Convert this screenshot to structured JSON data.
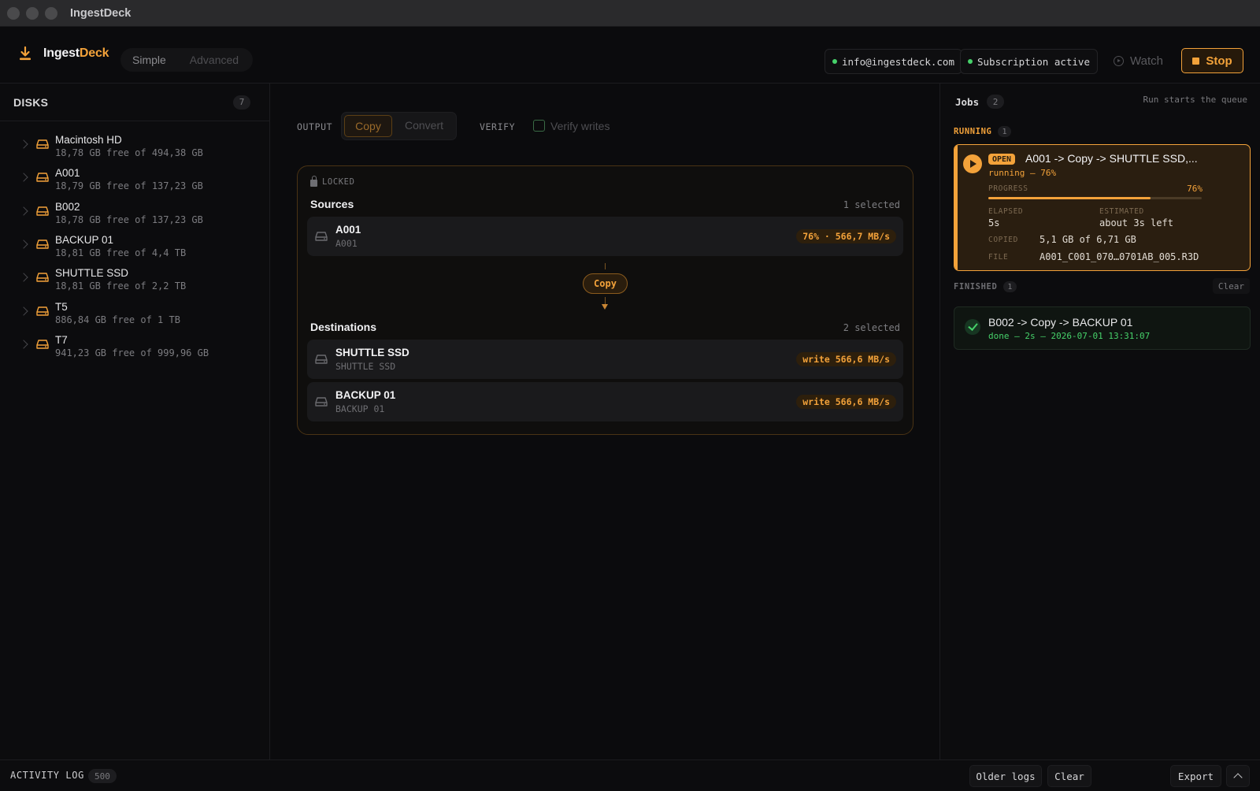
{
  "window": {
    "title": "IngestDeck"
  },
  "brand": {
    "name_main": "Ingest",
    "name_accent": "Deck"
  },
  "modes": [
    "Simple",
    "Advanced"
  ],
  "header": {
    "email": "info@ingestdeck.com",
    "subscription": "Subscription active",
    "watch_label": "Watch",
    "stop_label": "Stop"
  },
  "sidebar": {
    "title": "DISKS",
    "count": "7",
    "disks": [
      {
        "name": "Macintosh HD",
        "free": "18,78 GB free of 494,38 GB"
      },
      {
        "name": "A001",
        "free": "18,79 GB free of 137,23 GB"
      },
      {
        "name": "B002",
        "free": "18,78 GB free of 137,23 GB"
      },
      {
        "name": "BACKUP 01",
        "free": "18,81 GB free of 4,4 TB"
      },
      {
        "name": "SHUTTLE SSD",
        "free": "18,81 GB free of 2,2 TB"
      },
      {
        "name": "T5",
        "free": "886,84 GB free of 1 TB"
      },
      {
        "name": "T7",
        "free": "941,23 GB free of 999,96 GB"
      }
    ]
  },
  "toolbar": {
    "output_label": "OUTPUT",
    "copy": "Copy",
    "convert": "Convert",
    "verify_label": "VERIFY",
    "verify_writes": "Verify writes"
  },
  "flow": {
    "locked": "LOCKED",
    "sources_title": "Sources",
    "sources_count": "1 selected",
    "sources": [
      {
        "name": "A001",
        "sub": "A001",
        "tag": "76% · 566,7 MB/s"
      }
    ],
    "connector": "Copy",
    "dest_title": "Destinations",
    "dest_count": "2 selected",
    "destinations": [
      {
        "name": "SHUTTLE SSD",
        "sub": "SHUTTLE SSD",
        "tag": "write 566,6 MB/s"
      },
      {
        "name": "BACKUP 01",
        "sub": "BACKUP 01",
        "tag": "write 566,6 MB/s"
      }
    ]
  },
  "jobs": {
    "title": "Jobs",
    "count": "2",
    "note": "Run starts the queue",
    "running_label": "RUNNING",
    "running_count": "1",
    "running_job": {
      "tag": "OPEN",
      "title": "A001 -> Copy -> SHUTTLE SSD,...",
      "status": "running – 76%",
      "progress_label": "PROGRESS",
      "progress_pct": "76%",
      "progress_value": 0.76,
      "elapsed_label": "ELAPSED",
      "elapsed": "5s",
      "estimated_label": "ESTIMATED",
      "estimated": "about 3s left",
      "copied_label": "COPIED",
      "copied": "5,1 GB of 6,71 GB",
      "file_label": "FILE",
      "file": "A001_C001_070…0701AB_005.R3D"
    },
    "finished_label": "FINISHED",
    "finished_count": "1",
    "clear_label": "Clear",
    "finished_job": {
      "title": "B002 -> Copy -> BACKUP 01",
      "status": "done – 2s – 2026-07-01 13:31:07"
    }
  },
  "footer": {
    "label": "ACTIVITY LOG",
    "count": "500",
    "older": "Older logs",
    "clear": "Clear",
    "export": "Export"
  },
  "colors": {
    "accent": "#f3a23a",
    "success": "#46d16a",
    "background": "#0b0b0d"
  }
}
